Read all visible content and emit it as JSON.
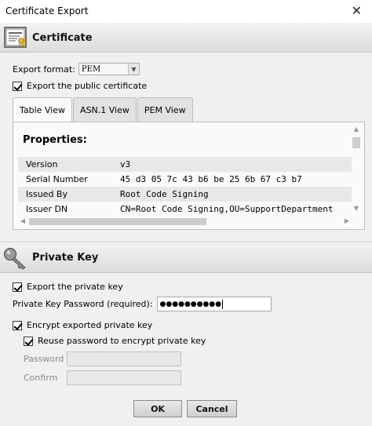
{
  "window": {
    "title": "Certificate Export",
    "close_glyph": "✕"
  },
  "certificate_section": {
    "title": "Certificate",
    "icon": "certificate-icon"
  },
  "export_format": {
    "label": "Export format:",
    "value": "PEM"
  },
  "export_public": {
    "label": "Export the public certificate",
    "checked": true
  },
  "tabs": [
    {
      "label": "Table View",
      "active": true
    },
    {
      "label": "ASN.1 View",
      "active": false
    },
    {
      "label": "PEM View",
      "active": false
    }
  ],
  "properties": {
    "title": "Properties:",
    "rows": [
      {
        "key": "Version",
        "value": "v3"
      },
      {
        "key": "Serial Number",
        "value": "45 d3 05 7c 43 b6 be 25 6b 67 c3 b7"
      },
      {
        "key": "Issued By",
        "value": "Root Code Signing"
      },
      {
        "key": "Issuer DN",
        "value": "CN=Root Code Signing,OU=SupportDepartment"
      }
    ]
  },
  "private_key_section": {
    "title": "Private Key",
    "icon": "key-icon"
  },
  "export_private": {
    "label": "Export the private key",
    "checked": true
  },
  "private_key_password": {
    "label": "Private Key Password (required):",
    "masked_value": "●●●●●●●●●●"
  },
  "encrypt_private": {
    "label": "Encrypt exported private key",
    "checked": true
  },
  "reuse_password": {
    "label": "Reuse password to encrypt private key",
    "checked": true
  },
  "password_field": {
    "label": "Password",
    "value": ""
  },
  "confirm_field": {
    "label": "Confirm",
    "value": ""
  },
  "buttons": {
    "ok": "OK",
    "cancel": "Cancel"
  }
}
